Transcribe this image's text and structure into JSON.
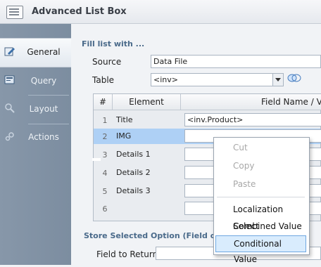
{
  "window": {
    "title": "Advanced List Box"
  },
  "sidebar": {
    "items": [
      {
        "label": "General",
        "icon": "pencil-icon",
        "active": true
      },
      {
        "label": "Query",
        "icon": "query-icon",
        "active": false
      },
      {
        "label": "Layout",
        "icon": "magnifier-icon",
        "active": false
      },
      {
        "label": "Actions",
        "icon": "gears-icon",
        "active": false
      }
    ]
  },
  "fill": {
    "header": "Fill list with ...",
    "source_label": "Source",
    "source_value": "Data File",
    "table_label": "Table",
    "table_value": "<inv>"
  },
  "grid": {
    "columns": [
      "#",
      "Element",
      "Field Name / Va"
    ],
    "rows": [
      {
        "num": "1",
        "element": "Title",
        "field": "<inv.Product>"
      },
      {
        "num": "2",
        "element": "IMG",
        "field": ""
      },
      {
        "num": "3",
        "element": "Details 1",
        "field": ""
      },
      {
        "num": "4",
        "element": "Details 2",
        "field": ""
      },
      {
        "num": "5",
        "element": "Details 3",
        "field": ""
      },
      {
        "num": "6",
        "element": "",
        "field": ""
      }
    ]
  },
  "store": {
    "header": "Store Selected Option (Field or Line",
    "field_label": "Field to Return",
    "field_value": ""
  },
  "context_menu": {
    "items": [
      {
        "label": "Cut",
        "enabled": false
      },
      {
        "label": "Copy",
        "enabled": false
      },
      {
        "label": "Paste",
        "enabled": false
      },
      {
        "label": "Localization Select",
        "enabled": true
      },
      {
        "label": "Combined Value",
        "enabled": true
      },
      {
        "label": "Conditional Value",
        "enabled": true,
        "highlighted": true
      }
    ]
  },
  "colors": {
    "sidebar": "#8495a8",
    "selection": "#aed0f5",
    "menu_highlight": "#d9ecfd"
  }
}
